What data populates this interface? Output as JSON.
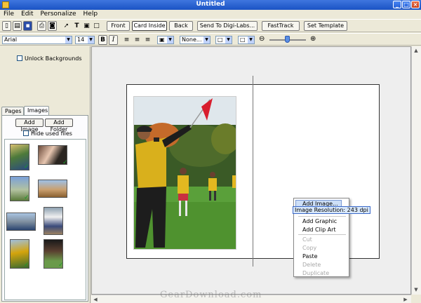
{
  "window": {
    "title": "Untitled"
  },
  "menu": [
    "File",
    "Edit",
    "Personalize",
    "Help"
  ],
  "toolbar": {
    "views": {
      "front": "Front",
      "card_inside": "Card Inside",
      "back": "Back"
    },
    "send": "Send To Digi-Labs...",
    "fasttrack": "FastTrack",
    "set_template": "Set Template"
  },
  "format": {
    "font": "Arial",
    "size": "14",
    "bold": "B",
    "italic": "I",
    "border_style": "None..."
  },
  "left_panel": {
    "unlock_backgrounds": "Unlock Backgrounds",
    "tabs": [
      {
        "label": "Pages"
      },
      {
        "label": "Images"
      }
    ],
    "add_image": "Add Image",
    "add_folder": "Add Folder",
    "hide_used": "Hide used files"
  },
  "context_menu": {
    "add_image": "Add Image...",
    "tooltip": "Image Resolution: 243 dpi",
    "add_graphic": "Add Graphic",
    "add_clip_art": "Add Clip Art",
    "cut": "Cut",
    "copy": "Copy",
    "paste": "Paste",
    "delete": "Delete",
    "duplicate": "Duplicate"
  },
  "watermark": "GearDownload.com",
  "colors": {
    "titlebar": "#2a5fd0",
    "accent": "#316ac5"
  }
}
